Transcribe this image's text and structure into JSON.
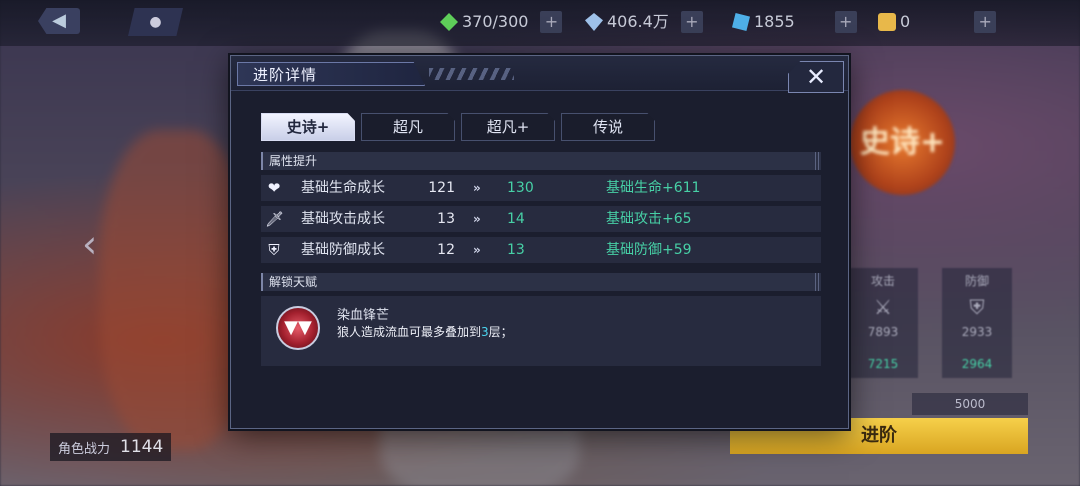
{
  "topbar": {
    "stamina": "370/300",
    "diamonds": "406.4万",
    "gems": "1855",
    "tickets": "0",
    "colors": {
      "stamina": "#5fcf5a",
      "diamond": "#9fc2ea",
      "gem": "#4fb0e8",
      "ticket": "#e8b84a"
    }
  },
  "background": {
    "power_label": "角色战力",
    "power_value": "1144",
    "badge_text": "史诗+",
    "advance_button": "进阶",
    "cost": "5000",
    "stats": [
      {
        "label": "攻击",
        "value": "7893",
        "next": "7215"
      },
      {
        "label": "防御",
        "value": "2933",
        "next": "2964"
      }
    ],
    "side_label": "进阶详情"
  },
  "modal": {
    "title": "进阶详情",
    "close_icon": "close-icon",
    "tabs": [
      {
        "label": "史诗+",
        "active": true
      },
      {
        "label": "超凡",
        "active": false
      },
      {
        "label": "超凡+",
        "active": false
      },
      {
        "label": "传说",
        "active": false
      }
    ],
    "attr_section": "属性提升",
    "attrs": [
      {
        "icon": "heart-icon",
        "name": "基础生命成长",
        "from": "121",
        "to": "130",
        "bonus": "基础生命+611"
      },
      {
        "icon": "sword-icon",
        "name": "基础攻击成长",
        "from": "13",
        "to": "14",
        "bonus": "基础攻击+65"
      },
      {
        "icon": "shield-icon",
        "name": "基础防御成长",
        "from": "12",
        "to": "13",
        "bonus": "基础防御+59"
      }
    ],
    "talent_section": "解锁天赋",
    "talent": {
      "name": "染血锋芒",
      "desc_prefix": "狼人造成流血可最多叠加到",
      "desc_highlight": "3",
      "desc_suffix": "层；"
    },
    "accent_green": "#47d0a6",
    "accent_cyan": "#4ad6f0"
  }
}
